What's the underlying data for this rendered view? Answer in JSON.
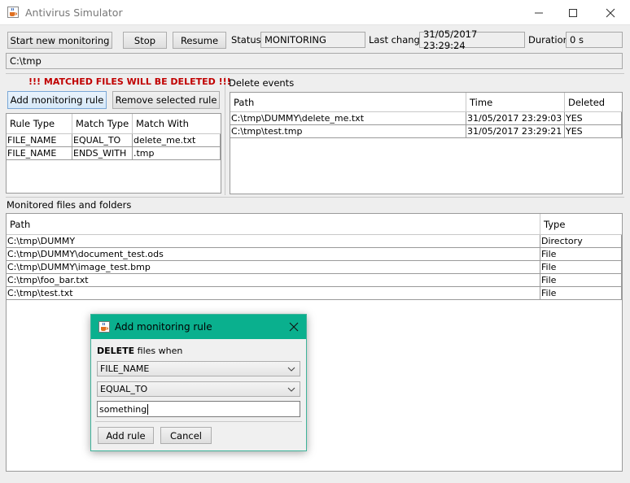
{
  "window": {
    "title": "Antivirus Simulator"
  },
  "toolbar": {
    "start_label": "Start new monitoring",
    "stop_label": "Stop",
    "resume_label": "Resume",
    "status_label": "Status",
    "status_value": "MONITORING",
    "last_change_label": "Last change",
    "last_change_value": "31/05/2017 23:29:24",
    "duration_label": "Duration",
    "duration_value": "0 s"
  },
  "path_field": {
    "value": "C:\\tmp"
  },
  "rules": {
    "warning": "!!! MATCHED FILES WILL BE DELETED !!!",
    "add_label": "Add monitoring rule",
    "remove_label": "Remove selected rule",
    "headers": [
      "Rule Type",
      "Match Type",
      "Match With"
    ],
    "rows": [
      [
        "FILE_NAME",
        "EQUAL_TO",
        "delete_me.txt"
      ],
      [
        "FILE_NAME",
        "ENDS_WITH",
        ".tmp"
      ]
    ]
  },
  "delete_events": {
    "title": "Delete events",
    "headers": [
      "Path",
      "Time",
      "Deleted"
    ],
    "rows": [
      [
        "C:\\tmp\\DUMMY\\delete_me.txt",
        "31/05/2017 23:29:03",
        "YES"
      ],
      [
        "C:\\tmp\\test.tmp",
        "31/05/2017 23:29:21",
        "YES"
      ]
    ]
  },
  "monitored": {
    "title": "Monitored files and folders",
    "headers": [
      "Path",
      "Type"
    ],
    "rows": [
      [
        "C:\\tmp\\DUMMY",
        "Directory"
      ],
      [
        "C:\\tmp\\DUMMY\\document_test.ods",
        "File"
      ],
      [
        "C:\\tmp\\DUMMY\\image_test.bmp",
        "File"
      ],
      [
        "C:\\tmp\\foo_bar.txt",
        "File"
      ],
      [
        "C:\\tmp\\test.txt",
        "File"
      ]
    ]
  },
  "dialog": {
    "title": "Add monitoring rule",
    "prompt_bold": "DELETE",
    "prompt_rest": " files when",
    "rule_type": "FILE_NAME",
    "match_type": "EQUAL_TO",
    "match_value": "something",
    "add_label": "Add rule",
    "cancel_label": "Cancel"
  },
  "colors": {
    "dialog_title": "#0ab08e",
    "warning": "#c00000"
  }
}
